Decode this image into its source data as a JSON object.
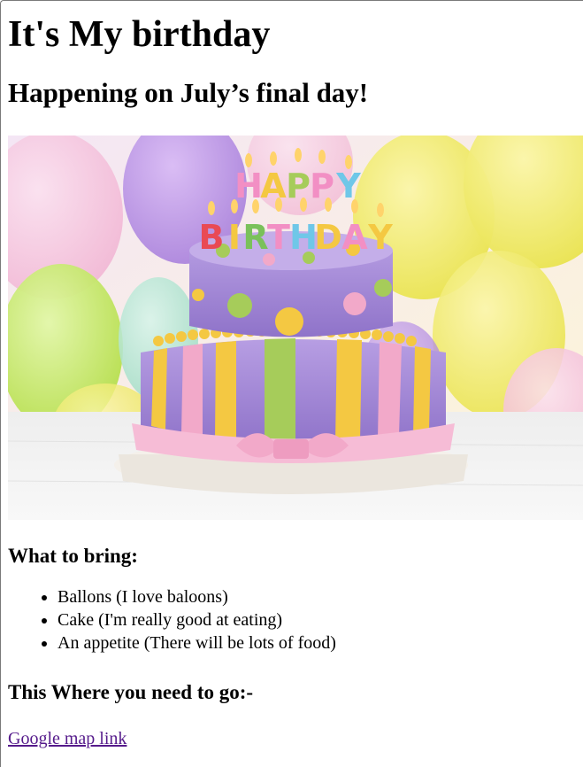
{
  "page": {
    "title": "It's My birthday",
    "subtitle": "Happening on July’s final day!"
  },
  "image": {
    "icon": "birthday-cake-image",
    "candle_letters": [
      "H",
      "A",
      "P",
      "P",
      "Y",
      "B",
      "I",
      "R",
      "T",
      "H",
      "D",
      "A",
      "Y"
    ],
    "colors": {
      "purple": "#a98bd6",
      "yellow": "#f4c842",
      "green": "#a6cc5a",
      "pink": "#f2a9c9",
      "cream": "#f7f3ec"
    }
  },
  "bring": {
    "heading": "What to bring:",
    "items": [
      "Ballons (I love baloons)",
      "Cake (I'm really good at eating)",
      "An appetite (There will be lots of food)"
    ]
  },
  "where": {
    "heading": "This Where you need to go:-",
    "link_label": "Google map link"
  },
  "theme": {
    "visited_link_color": "#551a8b"
  }
}
